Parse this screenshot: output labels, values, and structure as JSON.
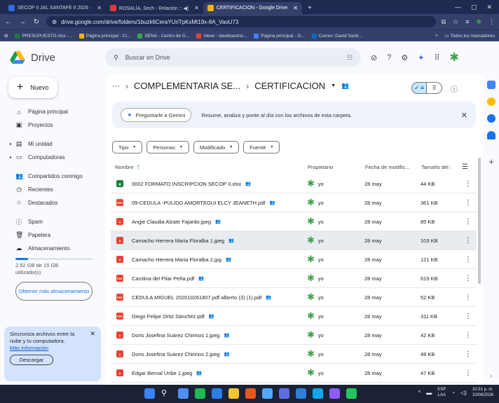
{
  "browser": {
    "tabs": [
      {
        "label": "SECOP II JAL SANTAFE II 2026 ·",
        "icon_color": "#2f6fde",
        "active": false
      },
      {
        "label": "ROSALÍA, Sech - Relación :: ◀)",
        "icon_color": "#e53935",
        "active": false
      },
      {
        "label": "CERTIFICACION - Google Drive",
        "icon_color": "#f4b400",
        "active": true
      }
    ],
    "new_tab": "+",
    "win_controls": [
      "—",
      "▢",
      "✕"
    ],
    "url": "drive.google.com/drive/folders/1buzk6CeraYUriTpKxMt19x-8A_VaoU73",
    "bookmarks": [
      {
        "label": "PRESUPUESTO.xlsx -...",
        "color": "#188038"
      },
      {
        "label": "Página principal - Cl...",
        "color": "#f4b400"
      },
      {
        "label": "SENA - Centro de G...",
        "color": "#3ca34a"
      },
      {
        "label": "Inbox - davidcastroi...",
        "color": "#ea4335"
      },
      {
        "label": "Página principal - G...",
        "color": "#4285f4"
      },
      {
        "label": "Correo: David Santi...",
        "color": "#0f6cbd"
      }
    ],
    "bookmarks_more": "»",
    "all_bookmarks": "Todos los marcadores"
  },
  "header": {
    "app_name": "Drive",
    "search_placeholder": "Buscar en Drive"
  },
  "sidebar": {
    "new_label": "Nuevo",
    "items": [
      {
        "label": "Página principal",
        "icon": "home-icon",
        "glyph": "⌂"
      },
      {
        "label": "Proyectos",
        "icon": "projects-icon",
        "glyph": "▣"
      },
      {
        "label": "Mi unidad",
        "icon": "my-drive-icon",
        "glyph": "▤"
      },
      {
        "label": "Computadoras",
        "icon": "computer-icon",
        "glyph": "▭"
      },
      {
        "label": "Compartidos conmigo",
        "icon": "shared-icon",
        "glyph": "👥"
      },
      {
        "label": "Recientes",
        "icon": "clock-icon",
        "glyph": "◷"
      },
      {
        "label": "Destacados",
        "icon": "star-icon",
        "glyph": "☆"
      },
      {
        "label": "Spam",
        "icon": "spam-icon",
        "glyph": "ⓘ"
      },
      {
        "label": "Papelera",
        "icon": "trash-icon",
        "glyph": "🗑"
      },
      {
        "label": "Almacenamiento",
        "icon": "cloud-icon",
        "glyph": "☁"
      }
    ],
    "storage_text": "2.52 GB de 15 GB utilizado(s)",
    "storage_fraction": 0.168,
    "more_storage": "Obtener más almacenamiento",
    "sync": {
      "text": "Sincroniza archivos entre la nube y tu computadora.",
      "link": "Más información",
      "button": "Descargar"
    }
  },
  "main": {
    "breadcrumb": [
      "COMPLEMENTARIA SE...",
      "CERTIFICACION"
    ],
    "gemini_button": "Preguntarle a Gemini",
    "gemini_text": "Resume, analiza y ponte al día con los archivos de esta carpeta.",
    "filters": [
      "Tipo",
      "Personas",
      "Modificado",
      "Fuente"
    ],
    "columns": {
      "name": "Nombre",
      "owner": "Propietario",
      "date": "Fecha de modific...",
      "size": "Tamaño del :"
    },
    "files": [
      {
        "name": "0002 FORMATO INSCRIPCION SECOP II.xlsx",
        "type": "xls",
        "owner": "yo",
        "date": "28 may",
        "size": "44 KB",
        "highlight": false
      },
      {
        "name": "09-CEDULA -PULIDO AMORTEGUI ELCY JEANETH.pdf",
        "type": "pdf",
        "owner": "yo",
        "date": "28 may",
        "size": "361 KB",
        "highlight": false
      },
      {
        "name": "Angie Claudia Alzate Fajardo.jpeg",
        "type": "img",
        "owner": "yo",
        "date": "28 may",
        "size": "85 KB",
        "highlight": false
      },
      {
        "name": "Camacho Herrera Maria Floralba 1.jpeg",
        "type": "img",
        "owner": "yo",
        "date": "28 may",
        "size": "103 KB",
        "highlight": true
      },
      {
        "name": "Camacho Herrera Maria Floralba 2.jpg",
        "type": "img",
        "owner": "yo",
        "date": "28 may",
        "size": "121 KB",
        "highlight": false
      },
      {
        "name": "Carolina del Pilar Peña.pdf",
        "type": "pdf",
        "owner": "yo",
        "date": "28 may",
        "size": "619 KB",
        "highlight": false
      },
      {
        "name": "CEDULA MIGUEL 202010261807.pdf alberto (3) (1).pdf",
        "type": "pdf",
        "owner": "yo",
        "date": "28 may",
        "size": "52 KB",
        "highlight": false
      },
      {
        "name": "Diego Felipe Ortiz Sánchez.pdf",
        "type": "pdf",
        "owner": "yo",
        "date": "28 may",
        "size": "311 KB",
        "highlight": false
      },
      {
        "name": "Doris Josefina Suárez Chirinos 1.jpeg",
        "type": "img",
        "owner": "yo",
        "date": "28 may",
        "size": "42 KB",
        "highlight": false
      },
      {
        "name": "Doris Josefina Suárez Chirinos 2.jpeg",
        "type": "img",
        "owner": "yo",
        "date": "28 may",
        "size": "48 KB",
        "highlight": false
      },
      {
        "name": "Edgar Bernal Uribe 1.jpeg",
        "type": "img",
        "owner": "yo",
        "date": "28 may",
        "size": "47 KB",
        "highlight": false
      }
    ]
  },
  "taskbar": {
    "lang": "ESP",
    "lang_sub": "LAA",
    "time": "10:31 p. m.",
    "date": "10/06/2026",
    "app_colors": [
      "#3b82f6",
      "#f5f5f5",
      "#4f8ff7",
      "#1db954",
      "#2b7de9",
      "#f4c430",
      "#e8571b",
      "#4ea9ff",
      "#5b6ee1",
      "#2f7ed8",
      "#0ea5e9",
      "#8b5cf6",
      "#22c55e"
    ]
  }
}
